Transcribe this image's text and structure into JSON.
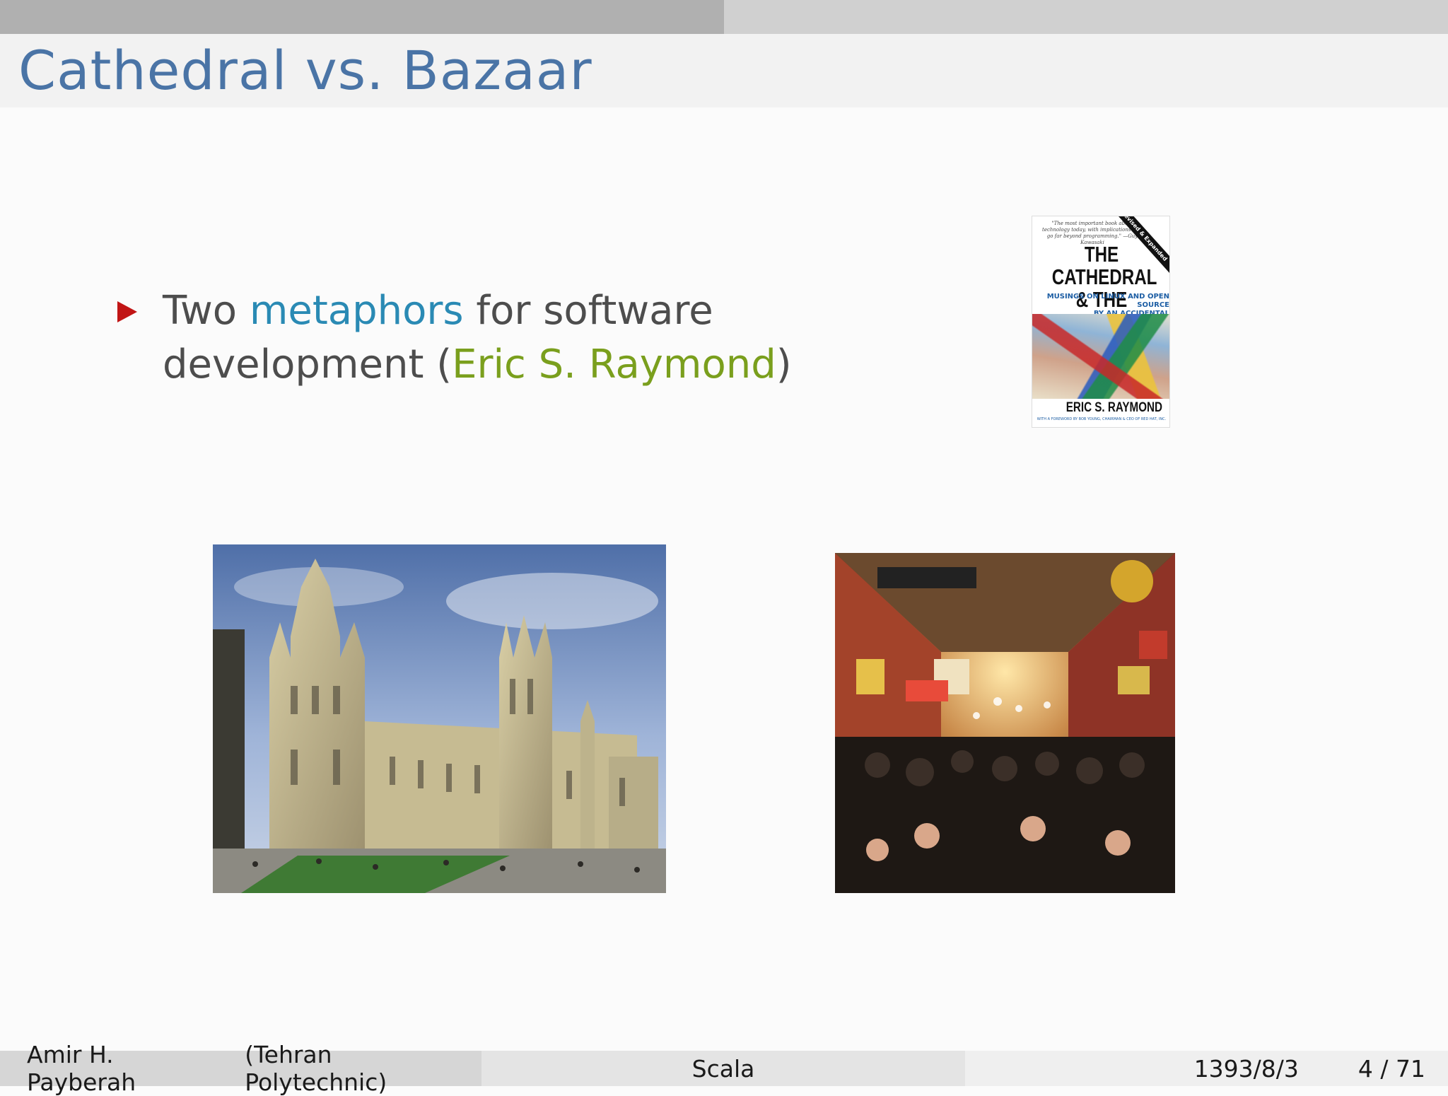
{
  "header": {
    "title": "Cathedral vs. Bazaar"
  },
  "bullet": {
    "part1": "Two ",
    "highlight1": "metaphors",
    "part2": " for software development (",
    "highlight2": "Eric S. Raymond",
    "part3": ")"
  },
  "book_cover": {
    "quote": "\"The most important book about technology today, with implications that go far beyond programming.\" —Guy Kawasaki",
    "ribbon": "Revised & Expanded",
    "title_line1": "THE CATHEDRAL",
    "title_line2": "& THE BAZAAR",
    "subtitle_line1": "MUSINGS ON LINUX AND OPEN SOURCE",
    "subtitle_line2": "BY AN ACCIDENTAL REVOLUTIONARY",
    "author": "ERIC S. RAYMOND",
    "foreword": "WITH A FOREWORD BY BOB YOUNG, CHAIRMAN & CEO OF RED HAT, INC."
  },
  "footer": {
    "author": "Amir H. Payberah",
    "institution": "(Tehran Polytechnic)",
    "topic": "Scala",
    "date": "1393/8/3",
    "page": "4 / 71"
  },
  "colors": {
    "title": "#4a74a6",
    "highlight_blue": "#2a8ab4",
    "highlight_green": "#7a9f1d",
    "bullet_marker": "#c11515"
  },
  "progress": {
    "fraction": 0.5
  }
}
